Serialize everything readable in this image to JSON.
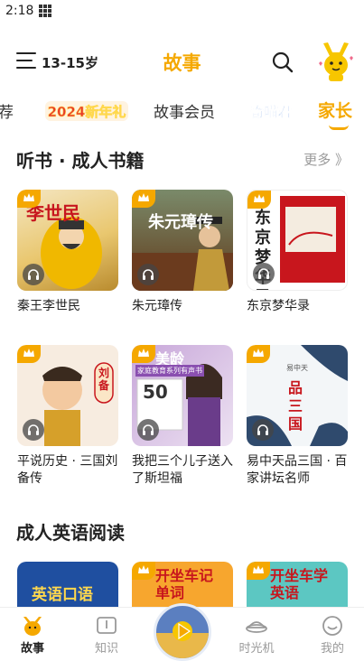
{
  "status_bar": {
    "time": "2:18"
  },
  "header": {
    "age_range": "13-15岁",
    "title": "故事"
  },
  "tabs": {
    "partial_left": "荐",
    "badge_2024": "2024新年礼",
    "members": "故事会员",
    "badge_qmj": "奇喵君",
    "parents": "家长"
  },
  "section1": {
    "title": "听书 · 成人书籍",
    "more": "更多 》",
    "books": [
      {
        "title": "秦王李世民",
        "cover_text": "李世民"
      },
      {
        "title": "朱元璋传",
        "cover_text": "朱元璋传"
      },
      {
        "title": "东京梦华录",
        "cover_text": "东京梦华录"
      },
      {
        "title": "平说历史 · 三国刘备传",
        "cover_text": "刘备"
      },
      {
        "title": "我把三个儿子送入了斯坦福",
        "cover_text": "美龄",
        "cover_sub": "家庭教育系列有声书",
        "cover_num": "50"
      },
      {
        "title": "易中天品三国 · 百家讲坛名师",
        "cover_text": "品三国",
        "cover_sub": "易中天"
      }
    ]
  },
  "section2": {
    "title": "成人英语阅读",
    "books": [
      {
        "cover_text": "英语口语"
      },
      {
        "cover_text": "开坐车记单词"
      },
      {
        "cover_text": "开坐车学英语"
      }
    ]
  },
  "bottom_nav": {
    "story": "故事",
    "knowledge": "知识",
    "time_machine": "时光机",
    "mine": "我的"
  },
  "colors": {
    "accent": "#f5a800"
  }
}
